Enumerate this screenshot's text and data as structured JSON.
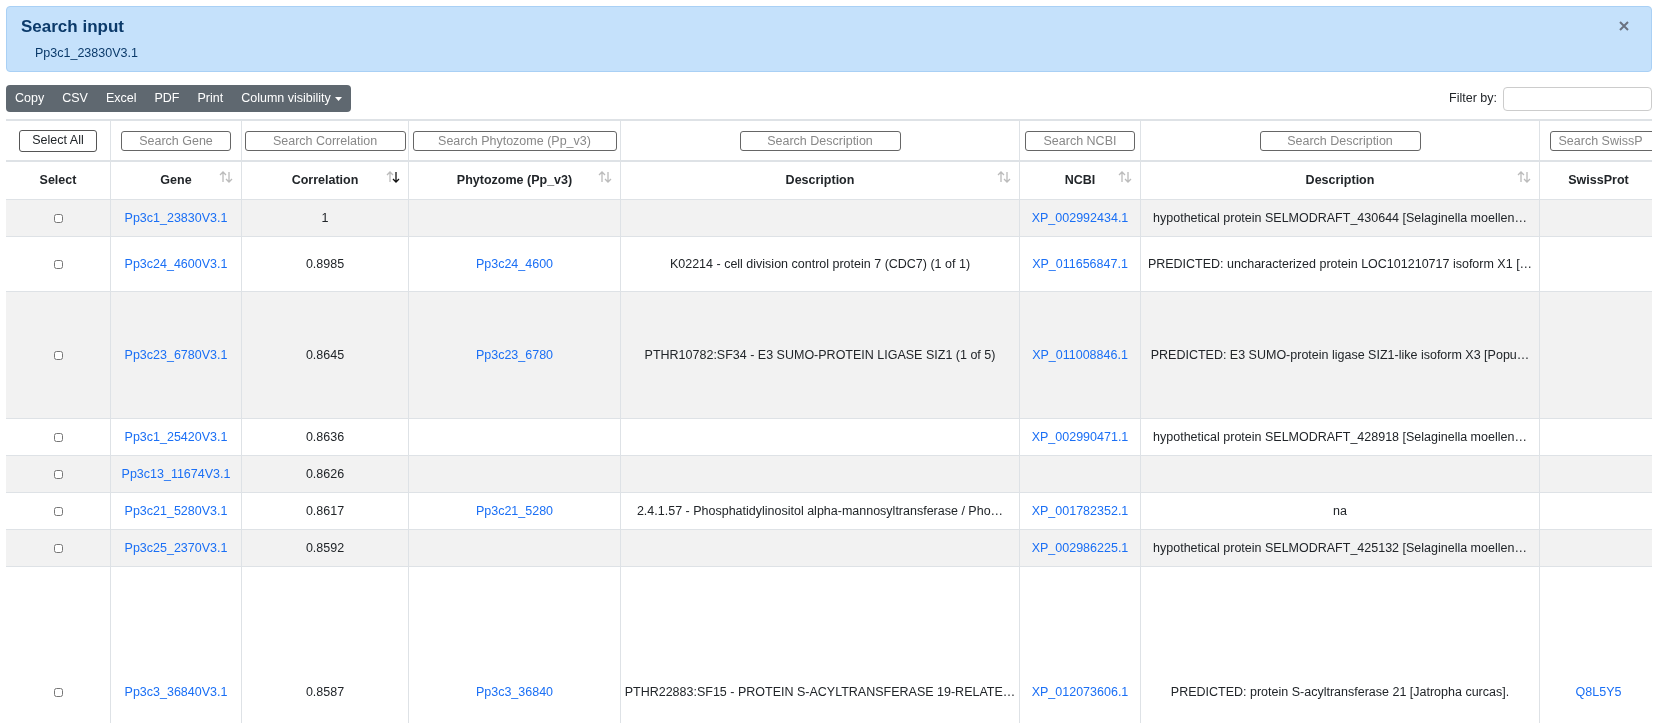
{
  "alert": {
    "title": "Search input",
    "text": "Pp3c1_23830V3.1"
  },
  "toolbar": {
    "buttons": [
      {
        "label": "Copy",
        "kind": "plain"
      },
      {
        "label": "CSV",
        "kind": "plain"
      },
      {
        "label": "Excel",
        "kind": "plain"
      },
      {
        "label": "PDF",
        "kind": "plain"
      },
      {
        "label": "Print",
        "kind": "plain"
      },
      {
        "label": "Column visibility",
        "kind": "dropdown"
      }
    ]
  },
  "filter": {
    "label": "Filter by:"
  },
  "table": {
    "select_column": {
      "label": "Select",
      "button": "Select All"
    },
    "columns": [
      {
        "label": "Gene",
        "kind": "link",
        "placeholder": "Search Gene",
        "sorted": false
      },
      {
        "label": "Correlation",
        "kind": "text",
        "placeholder": "Search Correlation",
        "sorted": true
      },
      {
        "label": "Phytozome (Pp_v3)",
        "kind": "link",
        "placeholder": "Search Phytozome (Pp_v3)",
        "sorted": false
      },
      {
        "label": "Description",
        "kind": "text",
        "placeholder": "Search Description",
        "sorted": false
      },
      {
        "label": "NCBI",
        "kind": "link",
        "placeholder": "Search NCBI",
        "sorted": false
      },
      {
        "label": "Description",
        "kind": "text",
        "placeholder": "Search Description",
        "sorted": false
      },
      {
        "label": "SwissProt",
        "kind": "link",
        "placeholder": "Search SwissP"
      }
    ],
    "rows": [
      {
        "checked": false,
        "cells": [
          "Pp3c1_23830V3.1",
          "1",
          null,
          null,
          "XP_002992434.1",
          "hypothetical protein SELMODRAFT_430644 [Selaginella moellen…",
          null
        ]
      },
      {
        "checked": false,
        "cells": [
          "Pp3c24_4600V3.1",
          "0.8985",
          "Pp3c24_4600",
          "K02214 - cell division control protein 7 (CDC7) (1 of 1)",
          "XP_011656847.1",
          "PREDICTED: uncharacterized protein LOC101210717 isoform X1 […",
          null
        ]
      },
      {
        "checked": false,
        "cells": [
          "Pp3c23_6780V3.1",
          "0.8645",
          "Pp3c23_6780",
          "PTHR10782:SF34 - E3 SUMO-PROTEIN LIGASE SIZ1 (1 of 5)",
          "XP_011008846.1",
          "PREDICTED: E3 SUMO-protein ligase SIZ1-like isoform X3 [Popu…",
          null
        ]
      },
      {
        "checked": false,
        "cells": [
          "Pp3c1_25420V3.1",
          "0.8636",
          null,
          null,
          "XP_002990471.1",
          "hypothetical protein SELMODRAFT_428918 [Selaginella moellen…",
          null
        ]
      },
      {
        "checked": false,
        "cells": [
          "Pp3c13_11674V3.1",
          "0.8626",
          null,
          null,
          null,
          null,
          null
        ]
      },
      {
        "checked": false,
        "cells": [
          "Pp3c21_5280V3.1",
          "0.8617",
          "Pp3c21_5280",
          "2.4.1.57 - Phosphatidylinositol alpha-mannosyltransferase / Pho…",
          "XP_001782352.1",
          "na",
          null
        ]
      },
      {
        "checked": false,
        "cells": [
          "Pp3c25_2370V3.1",
          "0.8592",
          null,
          null,
          "XP_002986225.1",
          "hypothetical protein SELMODRAFT_425132 [Selaginella moellen…",
          null
        ]
      },
      {
        "checked": false,
        "cells": [
          "Pp3c3_36840V3.1",
          "0.8587",
          "Pp3c3_36840",
          "PTHR22883:SF15 - PROTEIN S-ACYLTRANSFERASE 19-RELATE…",
          "XP_012073606.1",
          "PREDICTED: protein S-acyltransferase 21 [Jatropha curcas].",
          "Q8L5Y5"
        ]
      }
    ]
  }
}
